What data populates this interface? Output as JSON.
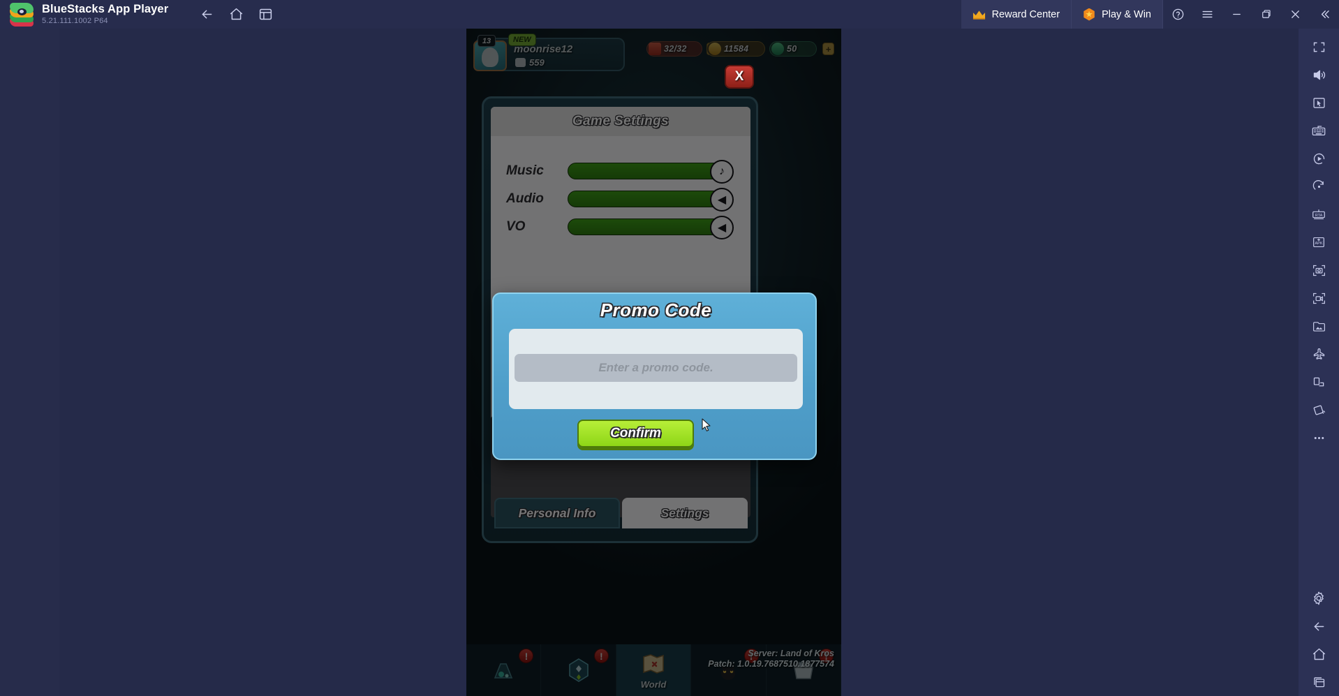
{
  "titlebar": {
    "app_name": "BlueStacks App Player",
    "version": "5.21.111.1002  P64",
    "back_icon": "back-arrow-icon",
    "home_icon": "home-icon",
    "multi_instance_icon": "multi-instance-icon",
    "chips": [
      {
        "label": "Reward Center",
        "icon": "crown-icon"
      },
      {
        "label": "Play & Win",
        "icon": "hex-star-icon"
      }
    ],
    "window_buttons": [
      {
        "name": "help-button",
        "glyph": "?"
      },
      {
        "name": "menu-button",
        "glyph": "≡"
      },
      {
        "name": "minimize-button",
        "glyph": "—"
      },
      {
        "name": "maximize-button",
        "glyph": "❐"
      },
      {
        "name": "close-button",
        "glyph": "✕"
      },
      {
        "name": "collapse-sidebar-button",
        "glyph": "«"
      }
    ]
  },
  "sidebar": {
    "items": [
      {
        "name": "fullscreen-icon",
        "label": "Full screen"
      },
      {
        "name": "volume-icon",
        "label": "Volume"
      },
      {
        "name": "pointer-mapping-icon",
        "label": "Pointer mapping"
      },
      {
        "name": "keyboard-controls-icon",
        "label": "Game controls"
      },
      {
        "name": "macro-recorder-icon",
        "label": "Macro recorder"
      },
      {
        "name": "rotate-icon",
        "label": "Rotate"
      },
      {
        "name": "rta-icon",
        "label": "Real-time translation"
      },
      {
        "name": "apk-install-icon",
        "label": "Install APK"
      },
      {
        "name": "screenshot-icon",
        "label": "Screenshot"
      },
      {
        "name": "screen-record-icon",
        "label": "Screen record"
      },
      {
        "name": "media-manager-icon",
        "label": "Media manager"
      },
      {
        "name": "airplane-icon",
        "label": "Shake"
      },
      {
        "name": "multi-window-icon",
        "label": "Multi window"
      },
      {
        "name": "tilt-icon",
        "label": "Tilt"
      },
      {
        "name": "more-icon",
        "label": "More"
      },
      {
        "name": "settings-gear-icon",
        "label": "Settings"
      },
      {
        "name": "back-icon",
        "label": "Back"
      },
      {
        "name": "home-icon",
        "label": "Home"
      },
      {
        "name": "recents-icon",
        "label": "Recent apps"
      }
    ]
  },
  "game": {
    "hud": {
      "level": "13",
      "new_badge": "NEW",
      "player_name": "moonrise12",
      "player_points": "559",
      "resources": [
        {
          "name": "energy",
          "value": "32/32"
        },
        {
          "name": "gold",
          "value": "11584"
        },
        {
          "name": "gem",
          "value": "50"
        }
      ]
    },
    "settings_panel": {
      "title": "Game Settings",
      "close_glyph": "X",
      "sliders": [
        {
          "label": "Music",
          "icon": "music-note-icon",
          "glyph": "♪",
          "value": 100
        },
        {
          "label": "Audio",
          "icon": "speaker-icon",
          "glyph": "◀",
          "value": 100
        },
        {
          "label": "VO",
          "icon": "speaker-icon",
          "glyph": "◀",
          "value": 100
        }
      ],
      "tabs": [
        {
          "label": "Personal Info",
          "active": false
        },
        {
          "label": "Settings",
          "active": true
        }
      ]
    },
    "bottom_nav": [
      {
        "label": "",
        "icon": "alchemy-icon",
        "alert": "!",
        "active": false
      },
      {
        "label": "",
        "icon": "gem-quest-icon",
        "alert": "!",
        "active": false
      },
      {
        "label": "World",
        "icon": "map-icon",
        "alert": "",
        "active": true
      },
      {
        "label": "",
        "icon": "pet-icon",
        "alert": "!",
        "active": false
      },
      {
        "label": "",
        "icon": "shop-icon",
        "alert": "!",
        "active": false
      }
    ],
    "server_line1": "Server: Land of Kros",
    "server_line2": "Patch: 1.0.19.7687510.1877574"
  },
  "promo_modal": {
    "title": "Promo Code",
    "input_value": "",
    "input_placeholder": "Enter a promo code.",
    "confirm_label": "Confirm"
  },
  "colors": {
    "titlebar_bg": "#272c4d",
    "sidebar_bg": "#2c3155",
    "modal_blue": "#4f9fca",
    "confirm_green": "#9ee024",
    "accent_orange": "#f08a1b",
    "slider_green": "#3d9b17"
  }
}
